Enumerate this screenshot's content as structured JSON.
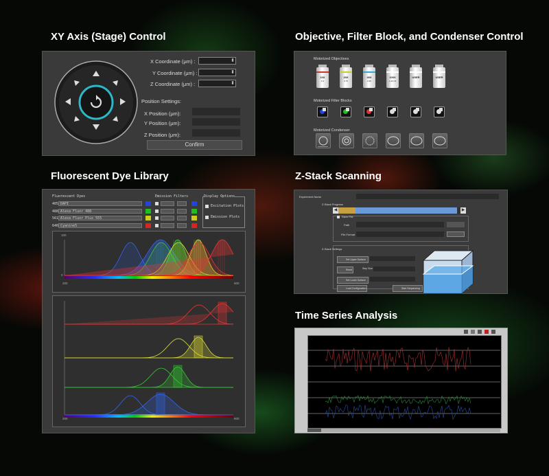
{
  "xy": {
    "title": "XY Axis (Stage) Control",
    "x_label": "X Coordinate (μm) :",
    "y_label": "Y Coordinate (μm)  :",
    "z_label": "Z Coordinate (μm) :",
    "position_settings": "Position Settings:",
    "x_pos_label": "X Position (μm)",
    "x_pos_colon": ":",
    "y_pos_label": "Y Position (μm):",
    "z_pos_label": "Z Position (μm):",
    "confirm": "Confirm"
  },
  "objective": {
    "title": "Objective, Filter Block, and Condenser Control",
    "objectives_label": "Motorized Objectives",
    "objectives": [
      {
        "mag": "10X",
        "na": "0.3",
        "band": "#cc3333"
      },
      {
        "mag": "20X",
        "na": "0.75",
        "band": "#cccc33"
      },
      {
        "mag": "40X",
        "na": "0.95",
        "band": "#33aacc"
      },
      {
        "mag": "100X",
        "na": "1.40 Oil",
        "band": "#ffffff"
      },
      {
        "mag": "USER",
        "na": "",
        "band": "#ffffff"
      },
      {
        "mag": "USER",
        "na": "",
        "band": "#ffffff"
      }
    ],
    "filter_label": "Motorized Filter Blocks",
    "condenser_label": "Motorized Condenser"
  },
  "dye": {
    "title": "Fluorescent Dye Library",
    "fluor_header": "Fluorescent Dyes",
    "emission_header": "Emission Filters",
    "display_header": "Display Options",
    "rows": [
      {
        "wl": "405",
        "name": "DAPI",
        "color": "#2244dd"
      },
      {
        "wl": "488",
        "name": "Alexa Fluor 488",
        "color": "#22bb22"
      },
      {
        "wl": "561",
        "name": "Alexa Fluor Plus 555",
        "color": "#cccc22"
      },
      {
        "wl": "640",
        "name": "Cyanine5",
        "color": "#dd2222"
      }
    ],
    "excitation": "Excitation Plots",
    "emission": "Emission Plots",
    "y_max": "100",
    "y_min": "0",
    "x_min": "300",
    "x_max": "800",
    "x_min2": "300",
    "x_max2": "800"
  },
  "zstack": {
    "title": "Z-Stack Scanning",
    "exp_name": "Experiment Name",
    "progress": "Z-Stack Progress",
    "save_file": "Save File",
    "path": "Path",
    "file_format": "File Format",
    "settings": "Z-Stack Settings",
    "set_upper": "Set Upper Surface",
    "reset": "Reset",
    "step_size": "Step Size",
    "set_lower": "Set Lower Surface",
    "load": "Load Configuration",
    "start": "Start Sequencing",
    "progress_fraction": 0.93
  },
  "timeseries": {
    "title": "Time Series Analysis"
  }
}
